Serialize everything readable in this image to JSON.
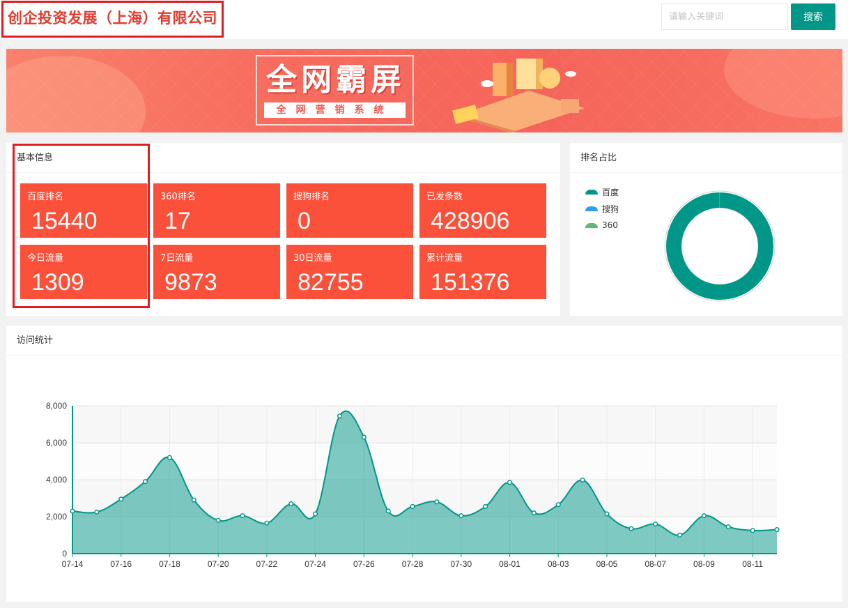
{
  "header": {
    "company": "创企投资发展（上海）有限公司",
    "search_placeholder": "请输入关键词",
    "search_button": "搜索"
  },
  "banner": {
    "title": "全网霸屏",
    "subtitle": "全网营销系统"
  },
  "basic_info": {
    "title": "基本信息",
    "stats": [
      {
        "label": "百度排名",
        "value": "15440"
      },
      {
        "label": "360排名",
        "value": "17"
      },
      {
        "label": "搜狗排名",
        "value": "0"
      },
      {
        "label": "已发条数",
        "value": "428906"
      },
      {
        "label": "今日流量",
        "value": "1309"
      },
      {
        "label": "7日流量",
        "value": "9873"
      },
      {
        "label": "30日流量",
        "value": "82755"
      },
      {
        "label": "累计流量",
        "value": "151376"
      }
    ]
  },
  "rank_share": {
    "title": "排名占比",
    "legend": [
      {
        "label": "百度",
        "color": "#009688"
      },
      {
        "label": "搜狗",
        "color": "#2f9df0"
      },
      {
        "label": "360",
        "color": "#5fb878"
      }
    ],
    "values": [
      15440,
      0,
      17
    ]
  },
  "visits": {
    "title": "访问统计"
  },
  "chart_data": {
    "type": "area",
    "x": [
      "07-14",
      "07-15",
      "07-16",
      "07-17",
      "07-18",
      "07-19",
      "07-20",
      "07-21",
      "07-22",
      "07-23",
      "07-24",
      "07-25",
      "07-26",
      "07-27",
      "07-28",
      "07-29",
      "07-30",
      "07-31",
      "08-01",
      "08-02",
      "08-03",
      "08-04",
      "08-05",
      "08-06",
      "08-07",
      "08-08",
      "08-09",
      "08-10",
      "08-11",
      "08-12"
    ],
    "xticks": [
      "07-14",
      "07-16",
      "07-18",
      "07-20",
      "07-22",
      "07-24",
      "07-26",
      "07-28",
      "07-30",
      "08-01",
      "08-03",
      "08-05",
      "08-07",
      "08-09",
      "08-11"
    ],
    "values": [
      2300,
      2250,
      2950,
      3900,
      5200,
      2900,
      1800,
      2050,
      1650,
      2700,
      2150,
      7450,
      6300,
      2300,
      2550,
      2800,
      2050,
      2550,
      3850,
      2200,
      2650,
      3980,
      2150,
      1350,
      1600,
      1000,
      2050,
      1450,
      1250,
      1300
    ],
    "ylim": [
      0,
      8000
    ],
    "yticks": [
      "0",
      "2,000",
      "4,000",
      "6,000",
      "8,000"
    ],
    "color": "#009688"
  }
}
